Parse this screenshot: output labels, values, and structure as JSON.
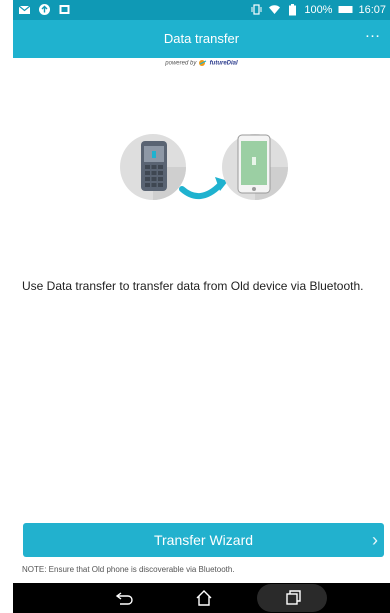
{
  "status_bar": {
    "left_icons": [
      "mail-icon",
      "upload-icon",
      "gallery-icon"
    ],
    "right_icons": [
      "vibrate-icon",
      "wifi-icon",
      "battery-icon"
    ],
    "battery": "100%",
    "time": "16:07"
  },
  "app_bar": {
    "title": "Data transfer",
    "overflow_icon": "more-icon"
  },
  "powered_by": {
    "prefix": "powered by",
    "brand": "futureDial"
  },
  "illustration": {
    "old_device_icon": "feature-phone-icon",
    "new_device_icon": "smartphone-icon",
    "arrow_icon": "curved-arrow-icon",
    "colors": {
      "circle": "#dedede",
      "accent": "#1fb2cf",
      "phone_dark": "#5a6473",
      "screen_green": "#9bcfa3"
    }
  },
  "description": "Use Data transfer to transfer data from Old device via Bluetooth.",
  "wizard_button": {
    "label": "Transfer Wizard",
    "icon": "chevron-right-icon"
  },
  "note": "NOTE: Ensure that Old phone is discoverable via Bluetooth.",
  "nav_bar": {
    "buttons": [
      "back-icon",
      "home-icon",
      "recent-apps-icon"
    ]
  }
}
